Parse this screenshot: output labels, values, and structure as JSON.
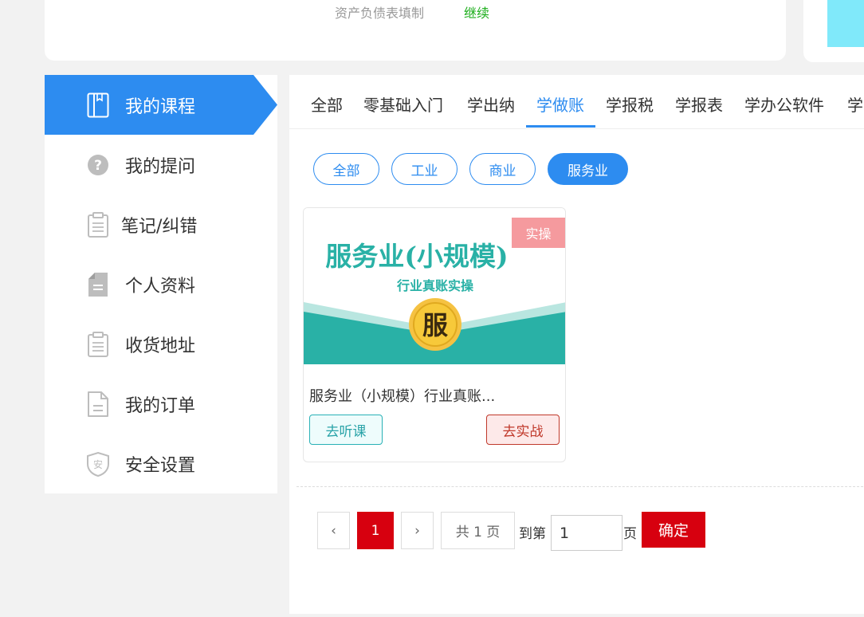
{
  "top": {
    "title": "资产负债表填制",
    "continue_label": "继续"
  },
  "sidebar": {
    "items": [
      {
        "label": "我的课程",
        "icon": "book-icon"
      },
      {
        "label": "我的提问",
        "icon": "question-icon"
      },
      {
        "label": "笔记/纠错",
        "icon": "clipboard-icon"
      },
      {
        "label": "个人资料",
        "icon": "document-icon"
      },
      {
        "label": "收货地址",
        "icon": "clipboard-icon"
      },
      {
        "label": "我的订单",
        "icon": "file-icon"
      },
      {
        "label": "安全设置",
        "icon": "shield-icon"
      }
    ]
  },
  "tabs": [
    "全部",
    "零基础入门",
    "学出纳",
    "学做账",
    "学报税",
    "学报表",
    "学办公软件",
    "学"
  ],
  "active_tab": "学做账",
  "filters": [
    "全部",
    "工业",
    "商业",
    "服务业"
  ],
  "active_filter": "服务业",
  "course": {
    "badge": "实操",
    "cover_title": "服务业(小规模)",
    "cover_subtitle": "行业真账实操",
    "cover_emblem": "服",
    "title": "服务业（小规模）行业真账...",
    "listen_label": "去听课",
    "practice_label": "去实战"
  },
  "pagination": {
    "prev": "‹",
    "current": "1",
    "next": "›",
    "total_label": "共 1 页",
    "goto_label": "到第",
    "input_value": "1",
    "page_label": "页",
    "confirm_label": "确定"
  },
  "colors": {
    "primary": "#2d8cf0",
    "red": "#d7000f",
    "teal": "#29b1a6",
    "green": "#1aad19"
  }
}
